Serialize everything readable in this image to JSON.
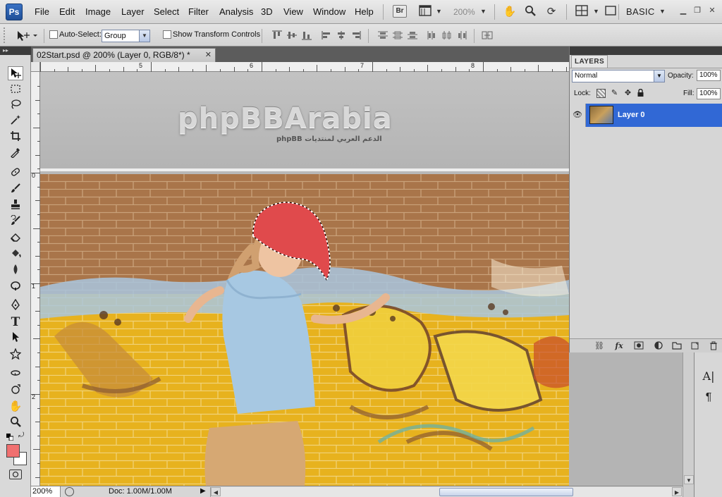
{
  "app": {
    "logo": "Ps",
    "menus": [
      "File",
      "Edit",
      "Image",
      "Layer",
      "Select",
      "Filter",
      "Analysis",
      "3D",
      "View",
      "Window",
      "Help"
    ],
    "bridge_label": "Br",
    "zoom_menu": "200%",
    "workspace": "BASIC"
  },
  "options_bar": {
    "auto_select_label": "Auto-Select:",
    "auto_select_checked": false,
    "auto_select_target": "Group",
    "show_transform_label": "Show Transform Controls",
    "show_transform_checked": false
  },
  "tools": [
    "move-icon",
    "marquee-icon",
    "lasso-icon",
    "quick-select-icon",
    "crop-icon",
    "eyedropper-icon",
    "healing-brush-icon",
    "brush-icon",
    "clone-stamp-icon",
    "history-brush-icon",
    "eraser-icon",
    "paint-bucket-icon",
    "blur-icon",
    "dodge-icon",
    "pen-icon",
    "type-icon",
    "path-select-icon",
    "shape-icon",
    "3d-rotate-icon",
    "3d-orbit-icon",
    "hand-icon",
    "zoom-icon"
  ],
  "colors": {
    "foreground": "#f07070",
    "background": "#ffffff",
    "selection": "#3168d5"
  },
  "document": {
    "tab_title": "02Start.psd @ 200% (Layer 0, RGB/8*) *",
    "ruler_h": [
      "5",
      "6",
      "7",
      "8"
    ],
    "ruler_v": [
      "0",
      "1",
      "2"
    ],
    "banner_title": "phpBBArabia",
    "banner_tagline": "الدعم العربي لمنتديات phpBB"
  },
  "status": {
    "zoom": "200%",
    "doc_info": "Doc: 1.00M/1.00M"
  },
  "layers_panel": {
    "tab": "LAYERS",
    "blend_mode": "Normal",
    "opacity_label": "Opacity:",
    "opacity": "100%",
    "lock_label": "Lock:",
    "fill_label": "Fill:",
    "fill": "100%",
    "layers": [
      {
        "name": "Layer 0",
        "visible": true,
        "selected": true
      }
    ]
  }
}
